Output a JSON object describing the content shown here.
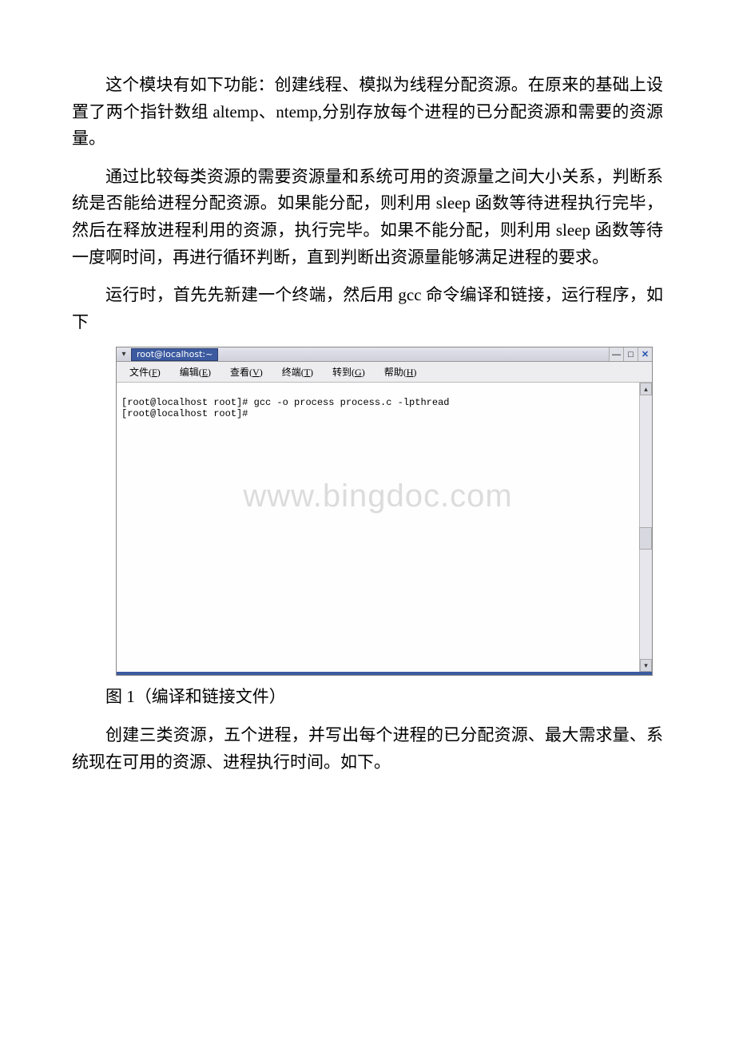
{
  "paragraphs": {
    "p1": "这个模块有如下功能：创建线程、模拟为线程分配资源。在原来的基础上设置了两个指针数组 altemp、ntemp,分别存放每个进程的已分配资源和需要的资源量。",
    "p2": "通过比较每类资源的需要资源量和系统可用的资源量之间大小关系，判断系统是否能给进程分配资源。如果能分配，则利用 sleep 函数等待进程执行完毕，然后在释放进程利用的资源，执行完毕。如果不能分配，则利用 sleep 函数等待一度啊时间，再进行循环判断，直到判断出资源量能够满足进程的要求。",
    "p3": "运行时，首先先新建一个终端，然后用 gcc 命令编译和链接，运行程序，如下",
    "caption": "图 1（编译和链接文件）",
    "p4": "创建三类资源，五个进程，并写出每个进程的已分配资源、最大需求量、系统现在可用的资源、进程执行时间。如下。"
  },
  "terminal": {
    "title": "root@localhost:~",
    "menu": {
      "file": "文件(F)",
      "edit": "编辑(E)",
      "view": "查看(V)",
      "term": "终端(T)",
      "go": "转到(G)",
      "help": "帮助(H)"
    },
    "lines": {
      "l1": "[root@localhost root]# gcc -o process process.c -lpthread",
      "l2": "[root@localhost root]# "
    },
    "watermark": "www.bingdoc.com",
    "buttons": {
      "min": "—",
      "max": "□",
      "close": "✕"
    },
    "scroll": {
      "up": "▴",
      "down": "▾"
    }
  }
}
